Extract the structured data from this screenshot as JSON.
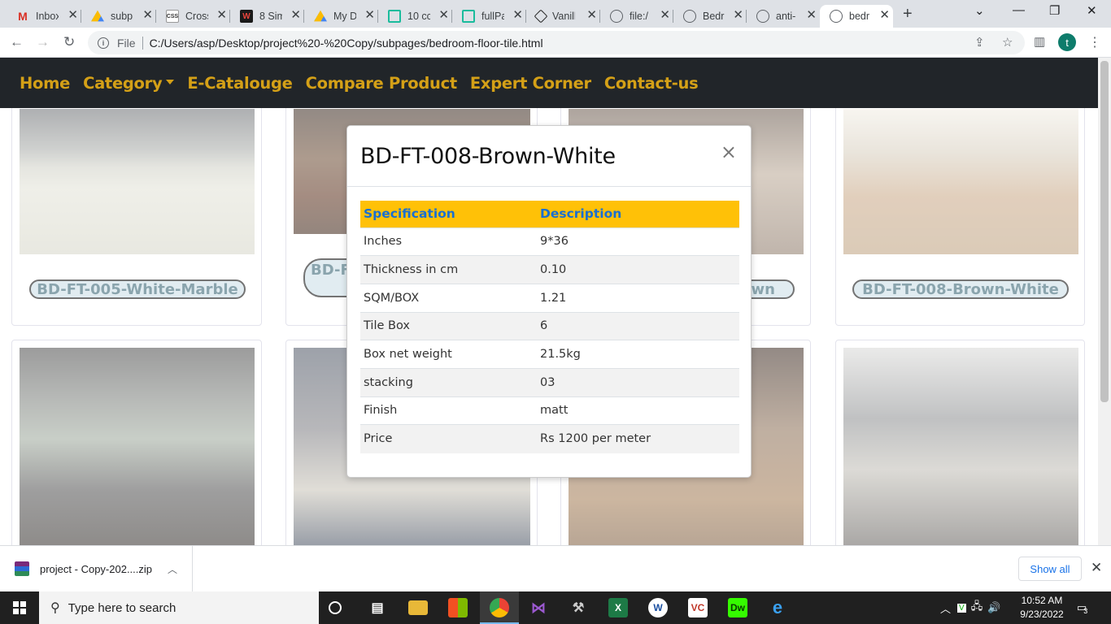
{
  "browser": {
    "tabs": [
      {
        "title": "Inbox",
        "icon": "gmail-icon"
      },
      {
        "title": "subp",
        "icon": "google-drive-icon"
      },
      {
        "title": "Cross",
        "icon": "css3-icon"
      },
      {
        "title": "8 Sim",
        "icon": "w-logo-icon"
      },
      {
        "title": "My D",
        "icon": "google-drive-icon"
      },
      {
        "title": "10 cc",
        "icon": "grid-icon"
      },
      {
        "title": "fullPa",
        "icon": "grid-icon"
      },
      {
        "title": "Vanill",
        "icon": "codepen-icon"
      },
      {
        "title": "file:/",
        "icon": "globe-icon"
      },
      {
        "title": "Bedr",
        "icon": "globe-icon"
      },
      {
        "title": "anti-",
        "icon": "globe-icon"
      },
      {
        "title": "bedr",
        "icon": "globe-icon"
      }
    ],
    "address": {
      "scheme_label": "File",
      "url": "C:/Users/asp/Desktop/project%20-%20Copy/subpages/bedroom-floor-tile.html"
    },
    "profile_initial": "t"
  },
  "site_nav": {
    "items": [
      "Home",
      "Category",
      "E-Catalouge",
      "Compare Product",
      "Expert Corner",
      "Contact-us"
    ],
    "color": "#d4a017"
  },
  "products": [
    {
      "name": "BD-FT-005-White-Marble"
    },
    {
      "name": "BD-FT"
    },
    {
      "name": "wn"
    },
    {
      "name": "BD-FT-008-Brown-White"
    }
  ],
  "modal": {
    "title": "BD-FT-008-Brown-White",
    "close_glyph": "×",
    "headers": [
      "Specification",
      "Description"
    ],
    "rows": [
      [
        "Inches",
        "9*36"
      ],
      [
        "Thickness in cm",
        "0.10"
      ],
      [
        "SQM/BOX",
        "1.21"
      ],
      [
        "Tile Box",
        "6"
      ],
      [
        "Box net weight",
        "21.5kg"
      ],
      [
        "stacking",
        "03"
      ],
      [
        "Finish",
        "matt"
      ],
      [
        "Price",
        "Rs 1200 per meter"
      ]
    ],
    "header_bg": "#ffc107",
    "header_color": "#1a6fd1"
  },
  "download": {
    "file": "project - Copy-202....zip",
    "show_all": "Show all"
  },
  "taskbar": {
    "search_placeholder": "Type here to search",
    "time": "10:52 AM",
    "date": "9/23/2022",
    "notification_count": "3"
  }
}
